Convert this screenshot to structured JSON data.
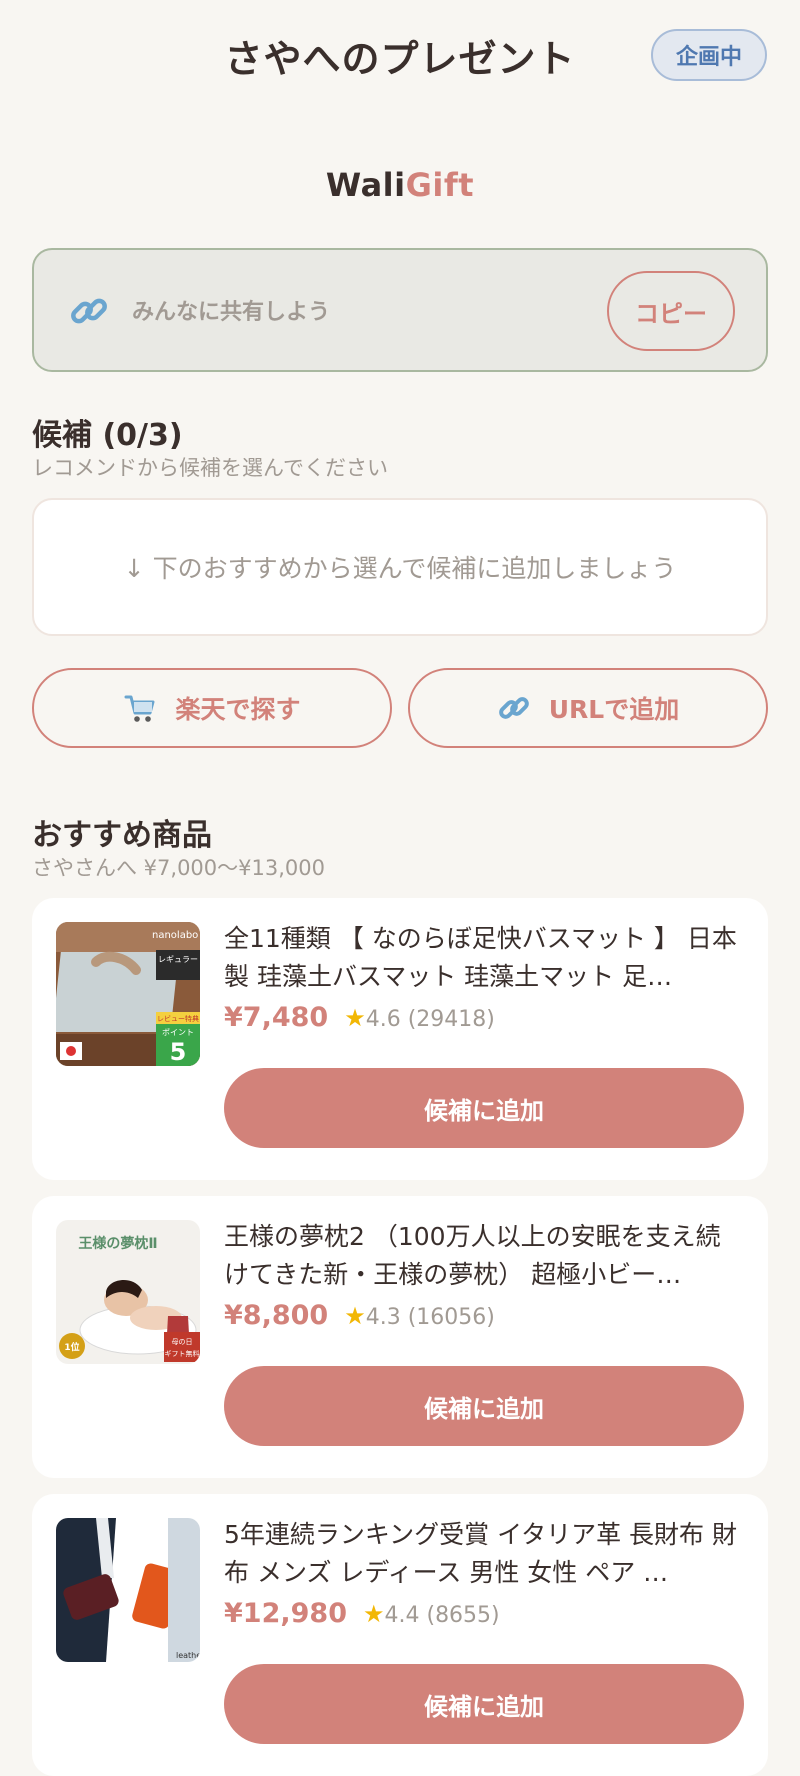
{
  "header": {
    "title": "さやへのプレゼント",
    "status": "企画中"
  },
  "logo": {
    "part1": "Wali",
    "part2": "Gift"
  },
  "share": {
    "text": "みんなに共有しよう",
    "copy_label": "コピー",
    "icon": "link-icon"
  },
  "candidates": {
    "title": "候補 (0/3)",
    "subtitle": "レコメンドから候補を選んでください",
    "empty_message": "↓ 下のおすすめから選んで候補に追加しましょう"
  },
  "actions": {
    "rakuten_label": "楽天で探す",
    "rakuten_icon": "cart-icon",
    "url_label": "URLで追加",
    "url_icon": "link-icon"
  },
  "recommend": {
    "title": "おすすめ商品",
    "subtitle": "さやさんへ ¥7,000〜¥13,000"
  },
  "products": [
    {
      "name": "全11種類 【 なのらぼ足快バスマット 】 日本製 珪藻土バスマット 珪藻土マット 足…",
      "price": "¥7,480",
      "rating": "4.6 (29418)",
      "button": "候補に追加",
      "thumb_badges": [
        "レギュラー",
        "レビュー特典",
        "ポイント",
        "5",
        "nanolabo"
      ]
    },
    {
      "name": "王様の夢枕2 （100万人以上の安眠を支え続けてきた新・王様の夢枕） 超極小ビー…",
      "price": "¥8,800",
      "rating": "4.3 (16056)",
      "button": "候補に追加",
      "thumb_badges": [
        "王様の夢枕Ⅱ",
        "1位",
        "母の日",
        "ギフト無料"
      ]
    },
    {
      "name": "5年連続ランキング受賞 イタリア革 長財布 財布 メンズ レディース 男性 女性 ペア …",
      "price": "¥12,980",
      "rating": "4.4 (8655)",
      "button": "候補に追加",
      "thumb_badges": [
        "leather"
      ]
    }
  ],
  "colors": {
    "background": "#f8f6f2",
    "accent": "#d2827a",
    "status_blue": "#4f78b0",
    "star": "#f2b705"
  }
}
